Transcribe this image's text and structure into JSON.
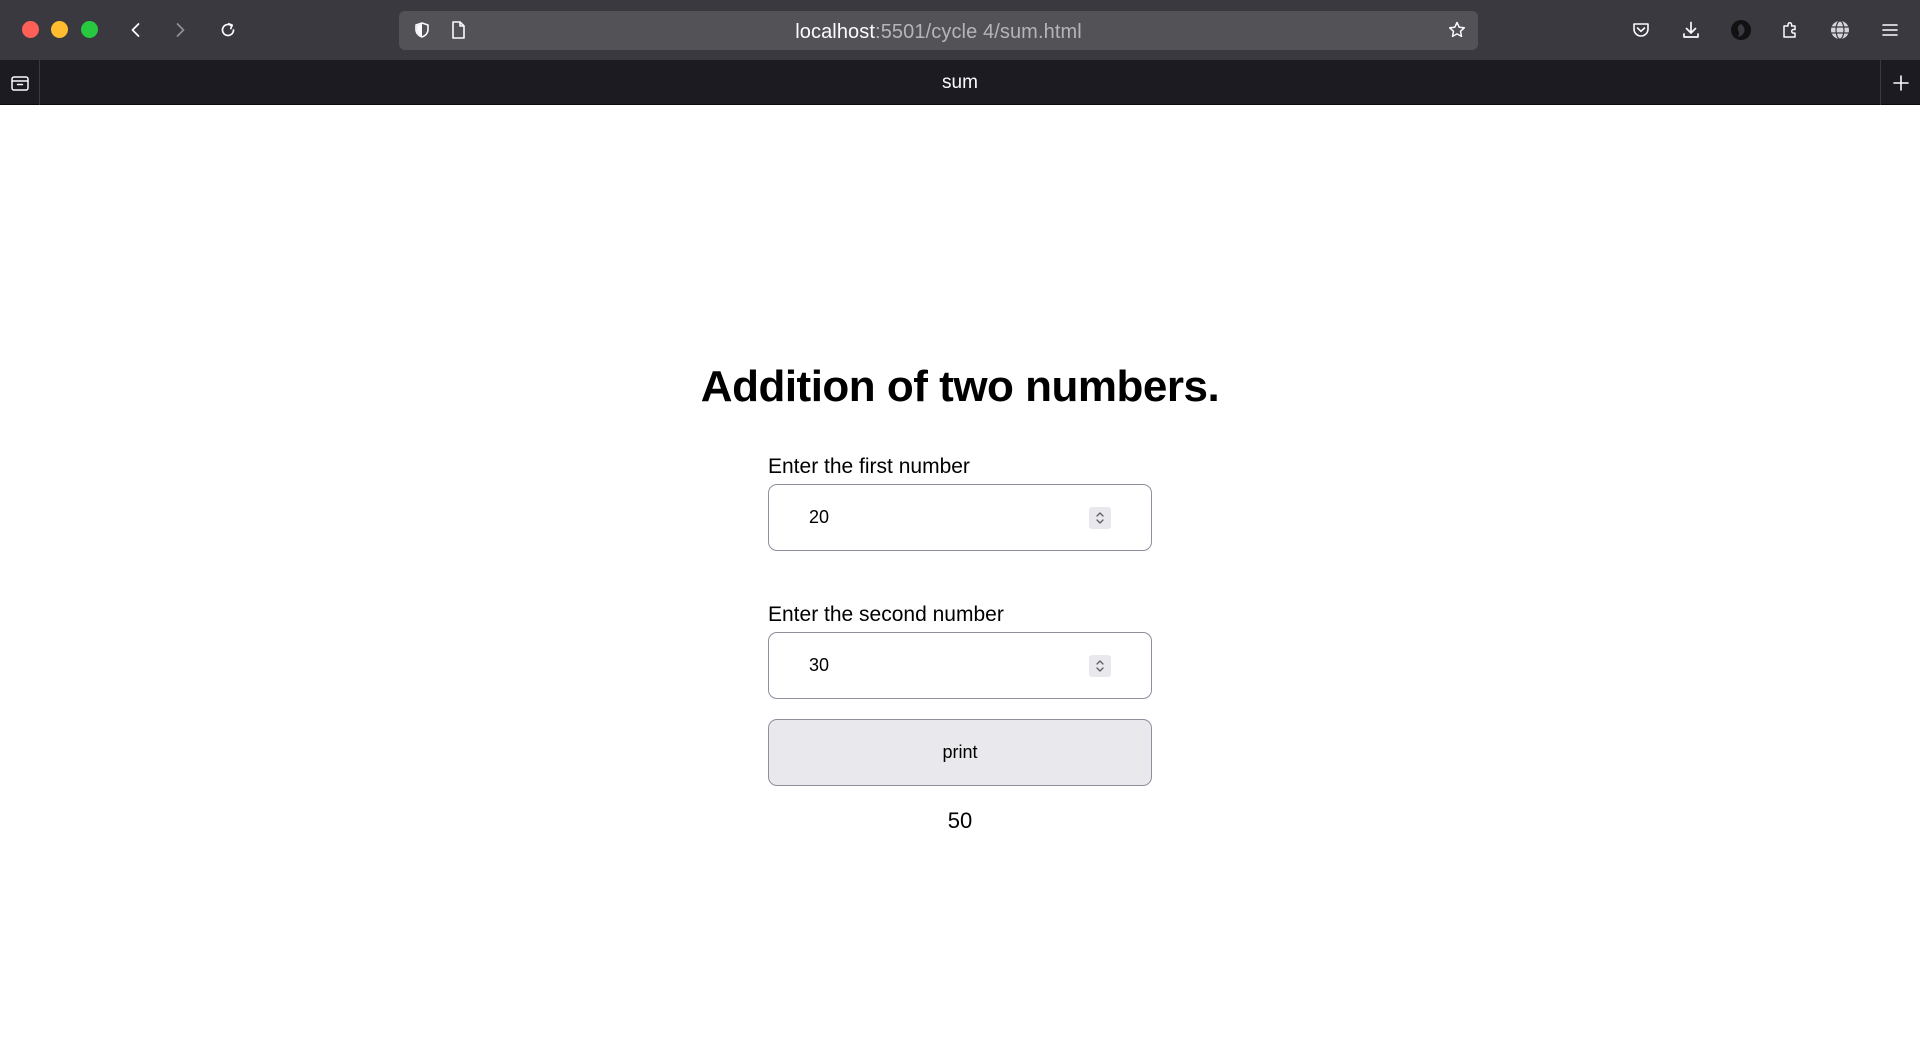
{
  "browser": {
    "url_host": "localhost",
    "url_path": ":5501/cycle 4/sum.html",
    "tab_title": "sum"
  },
  "page": {
    "heading": "Addition of two numbers.",
    "first_label": "Enter the first number",
    "first_value": "20",
    "second_label": "Enter the second number",
    "second_value": "30",
    "button_label": "print",
    "result": "50"
  }
}
